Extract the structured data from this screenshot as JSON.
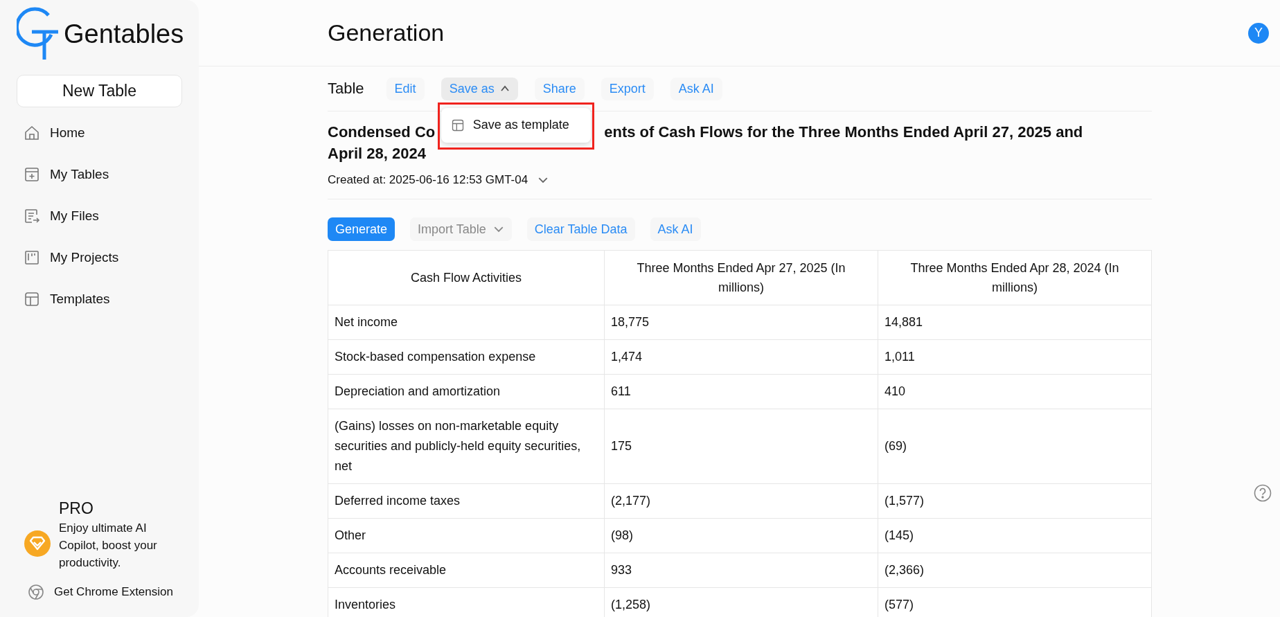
{
  "sidebar": {
    "brand": "Gentables",
    "new_table_button": "New Table",
    "nav_items": [
      {
        "label": "Home",
        "kind": "home"
      },
      {
        "label": "My Tables",
        "kind": "tables"
      },
      {
        "label": "My Files",
        "kind": "files"
      },
      {
        "label": "My Projects",
        "kind": "projects"
      },
      {
        "label": "Templates",
        "kind": "templates"
      }
    ],
    "promo": {
      "title": "PRO",
      "text": "Enjoy ultimate AI Copilot, boost your productivity."
    },
    "extension_link": "Get Chrome Extension"
  },
  "header": {
    "title": "Generation",
    "avatar": "Y"
  },
  "toolbar": {
    "label": "Table",
    "buttons": [
      {
        "label": "Edit",
        "kind": "plain",
        "expanded": false
      },
      {
        "label": "Save as",
        "kind": "menu",
        "expanded": true
      },
      {
        "label": "Share",
        "kind": "plain",
        "expanded": false
      },
      {
        "label": "Export",
        "kind": "plain",
        "expanded": false
      },
      {
        "label": "Ask AI",
        "kind": "plain",
        "expanded": false
      }
    ],
    "menu_items": [
      {
        "label": "Save as template"
      }
    ]
  },
  "document": {
    "title_parts": [
      "Condensed Co",
      "ents of Cash Flows for the Three Months Ended April 27, 2025 and",
      "April 28, 2024"
    ],
    "created_at": "Created at: 2025-06-16 12:53 GMT-04"
  },
  "actions": [
    {
      "label": "Generate",
      "kind": "primary"
    },
    {
      "label": "Import Table",
      "kind": "dropdown"
    },
    {
      "label": "Clear Table Data",
      "kind": "link"
    },
    {
      "label": "Ask AI",
      "kind": "link"
    }
  ],
  "table": {
    "columns": [
      "Cash Flow Activities",
      "Three Months Ended Apr 27, 2025 (In millions)",
      "Three Months Ended Apr 28, 2024 (In millions)"
    ],
    "rows": [
      [
        "Net income",
        "18,775",
        "14,881"
      ],
      [
        "Stock-based compensation expense",
        "1,474",
        "1,011"
      ],
      [
        "Depreciation and amortization",
        "611",
        "410"
      ],
      [
        "(Gains) losses on non-marketable equity securities and publicly-held equity securities, net",
        "175",
        "(69)"
      ],
      [
        "Deferred income taxes",
        "(2,177)",
        "(1,577)"
      ],
      [
        "Other",
        "(98)",
        "(145)"
      ],
      [
        "Accounts receivable",
        "933",
        "(2,366)"
      ],
      [
        "Inventories",
        "(1,258)",
        "(577)"
      ]
    ]
  }
}
